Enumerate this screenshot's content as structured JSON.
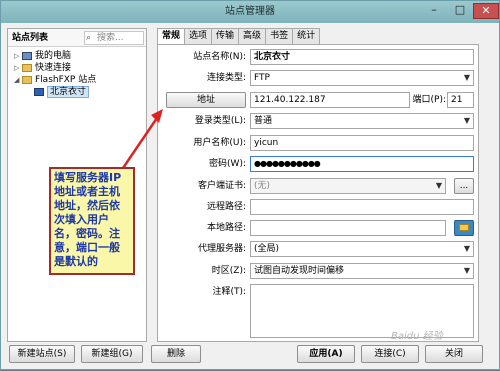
{
  "window": {
    "title": "站点管理器",
    "min": "–",
    "max": "□",
    "close": "✕"
  },
  "left": {
    "title": "站点列表",
    "search_placeholder": "搜索...",
    "tree": [
      {
        "label": "我的电脑",
        "icon": "computer-icon"
      },
      {
        "label": "快速连接",
        "icon": "folder-icon"
      },
      {
        "label": "FlashFXP 站点",
        "icon": "folder-icon"
      },
      {
        "label": "北京衣寸",
        "icon": "site-icon"
      }
    ]
  },
  "tabs": [
    "常规",
    "选项",
    "传输",
    "高级",
    "书签",
    "统计"
  ],
  "form": {
    "site_name_label": "站点名称(N):",
    "site_name_value": "北京衣寸",
    "conn_type_label": "连接类型:",
    "conn_type_value": "FTP",
    "address_button": "地址",
    "address_value": "121.40.122.187",
    "port_label": "端口(P):",
    "port_value": "21",
    "login_type_label": "登录类型(L):",
    "login_type_value": "普通",
    "username_label": "用户名称(U):",
    "username_value": "yicun",
    "password_label": "密码(W):",
    "password_value": "●●●●●●●●●●●",
    "client_cert_label": "客户端证书:",
    "client_cert_value": "(无)",
    "browse_label": "...",
    "remote_path_label": "远程路径:",
    "local_path_label": "本地路径:",
    "proxy_label": "代理服务器:",
    "proxy_value": "(全局)",
    "timezone_label": "时区(Z):",
    "timezone_value": "试图自动发现时间偏移",
    "notes_label": "注释(T):"
  },
  "callout": "填写服务器IP地址或者主机地址，然后依次填入用户名，密码。注意，端口一般是默认的",
  "buttons": {
    "new_site": "新建站点(S)",
    "new_group": "新建组(G)",
    "delete": "删除",
    "apply": "应用(A)",
    "connect": "连接(C)",
    "close": "关闭"
  },
  "watermark": "Baidu 经验"
}
